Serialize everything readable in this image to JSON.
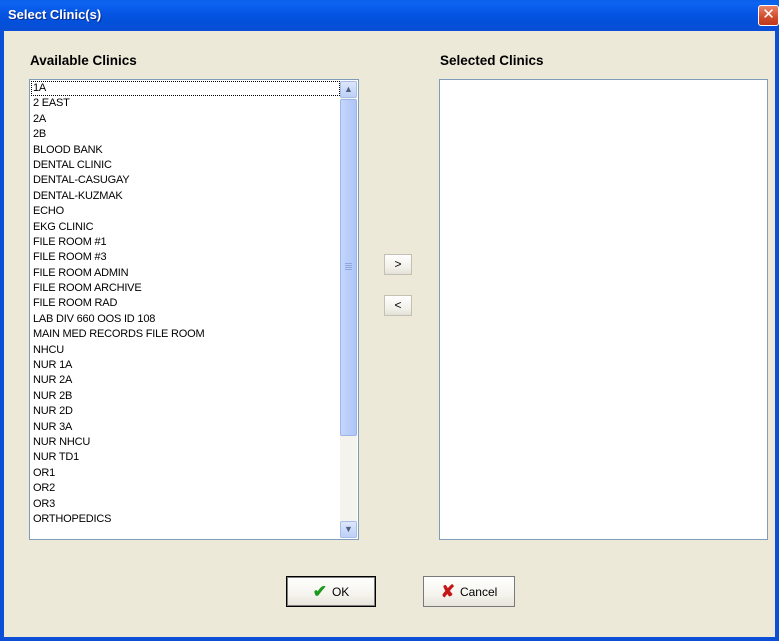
{
  "window": {
    "title": "Select Clinic(s)",
    "close_glyph": "✕"
  },
  "available": {
    "label": "Available Clinics",
    "items": [
      "1A",
      "2 EAST",
      "2A",
      "2B",
      "BLOOD BANK",
      "DENTAL CLINIC",
      "DENTAL-CASUGAY",
      "DENTAL-KUZMAK",
      "ECHO",
      "EKG CLINIC",
      "FILE ROOM #1",
      "FILE ROOM #3",
      "FILE ROOM ADMIN",
      "FILE ROOM ARCHIVE",
      "FILE ROOM RAD",
      "LAB DIV 660 OOS ID 108",
      "MAIN MED RECORDS FILE ROOM",
      "NHCU",
      "NUR 1A",
      "NUR 2A",
      "NUR 2B",
      "NUR 2D",
      "NUR 3A",
      "NUR NHCU",
      "NUR TD1",
      "OR1",
      "OR2",
      "OR3",
      "ORTHOPEDICS"
    ]
  },
  "selected": {
    "label": "Selected Clinics",
    "items": []
  },
  "buttons": {
    "add": ">",
    "remove": "<",
    "ok": "OK",
    "cancel": "Cancel"
  },
  "icons": {
    "ok": "checkmark-icon",
    "cancel": "red-x-icon",
    "scroll_up": "up-arrow-icon",
    "scroll_down": "down-arrow-icon"
  },
  "colors": {
    "titlebar": "#0a4fd6",
    "dialog_bg": "#ece9d8",
    "close_button": "#cf4a2c"
  }
}
